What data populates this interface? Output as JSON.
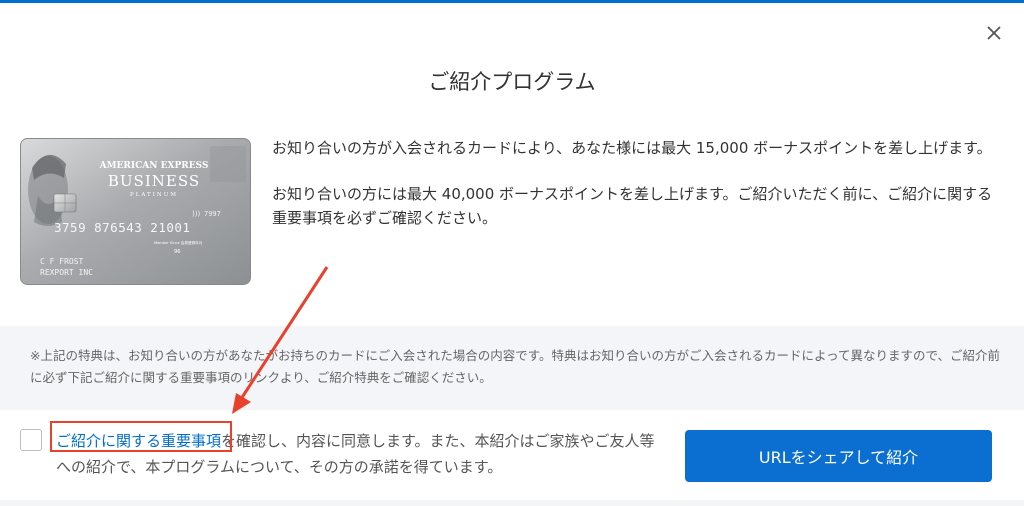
{
  "dialog": {
    "title": "ご紹介プログラム",
    "close_icon": "close-icon",
    "accent_color": "#006fcf",
    "panel_color": "#f3f5f8"
  },
  "card": {
    "brand": "AMERICAN EXPRESS",
    "product": "BUSINESS",
    "tier": "PLATINUM",
    "number": "3759 876543 21001",
    "cid": "7997",
    "holder": "C F FROST",
    "company": "REXPORT INC",
    "member_since_label": "Member Since 会員登録年月",
    "member_since_value": "96"
  },
  "content": {
    "paragraph1": "お知り合いの方が入会されるカードにより、あなた様には最大 15,000 ボーナスポイントを差し上げます。",
    "paragraph2": "お知り合いの方には最大 40,000 ボーナスポイントを差し上げます。ご紹介いただく前に、ご紹介に関する重要事項を必ずご確認ください。"
  },
  "note": {
    "text": "※上記の特典は、お知り合いの方があなたがお持ちのカードにご入会された場合の内容です。特典はお知り合いの方がご入会されるカードによって異なりますので、ご紹介前に必ず下記ご紹介に関する重要事項のリンクより、ご紹介特典をご確認ください。"
  },
  "agreement": {
    "link_text": "ご紹介に関する重要事項",
    "text": "を確認し、内容に同意します。また、本紹介はご家族やご友人等への紹介で、本プログラムについて、その方の承諾を得ています。",
    "checked": false
  },
  "actions": {
    "share_label": "URLをシェアして紹介",
    "button_color": "#0a6fd0"
  },
  "annotation": {
    "highlight_color": "#e8412c"
  }
}
